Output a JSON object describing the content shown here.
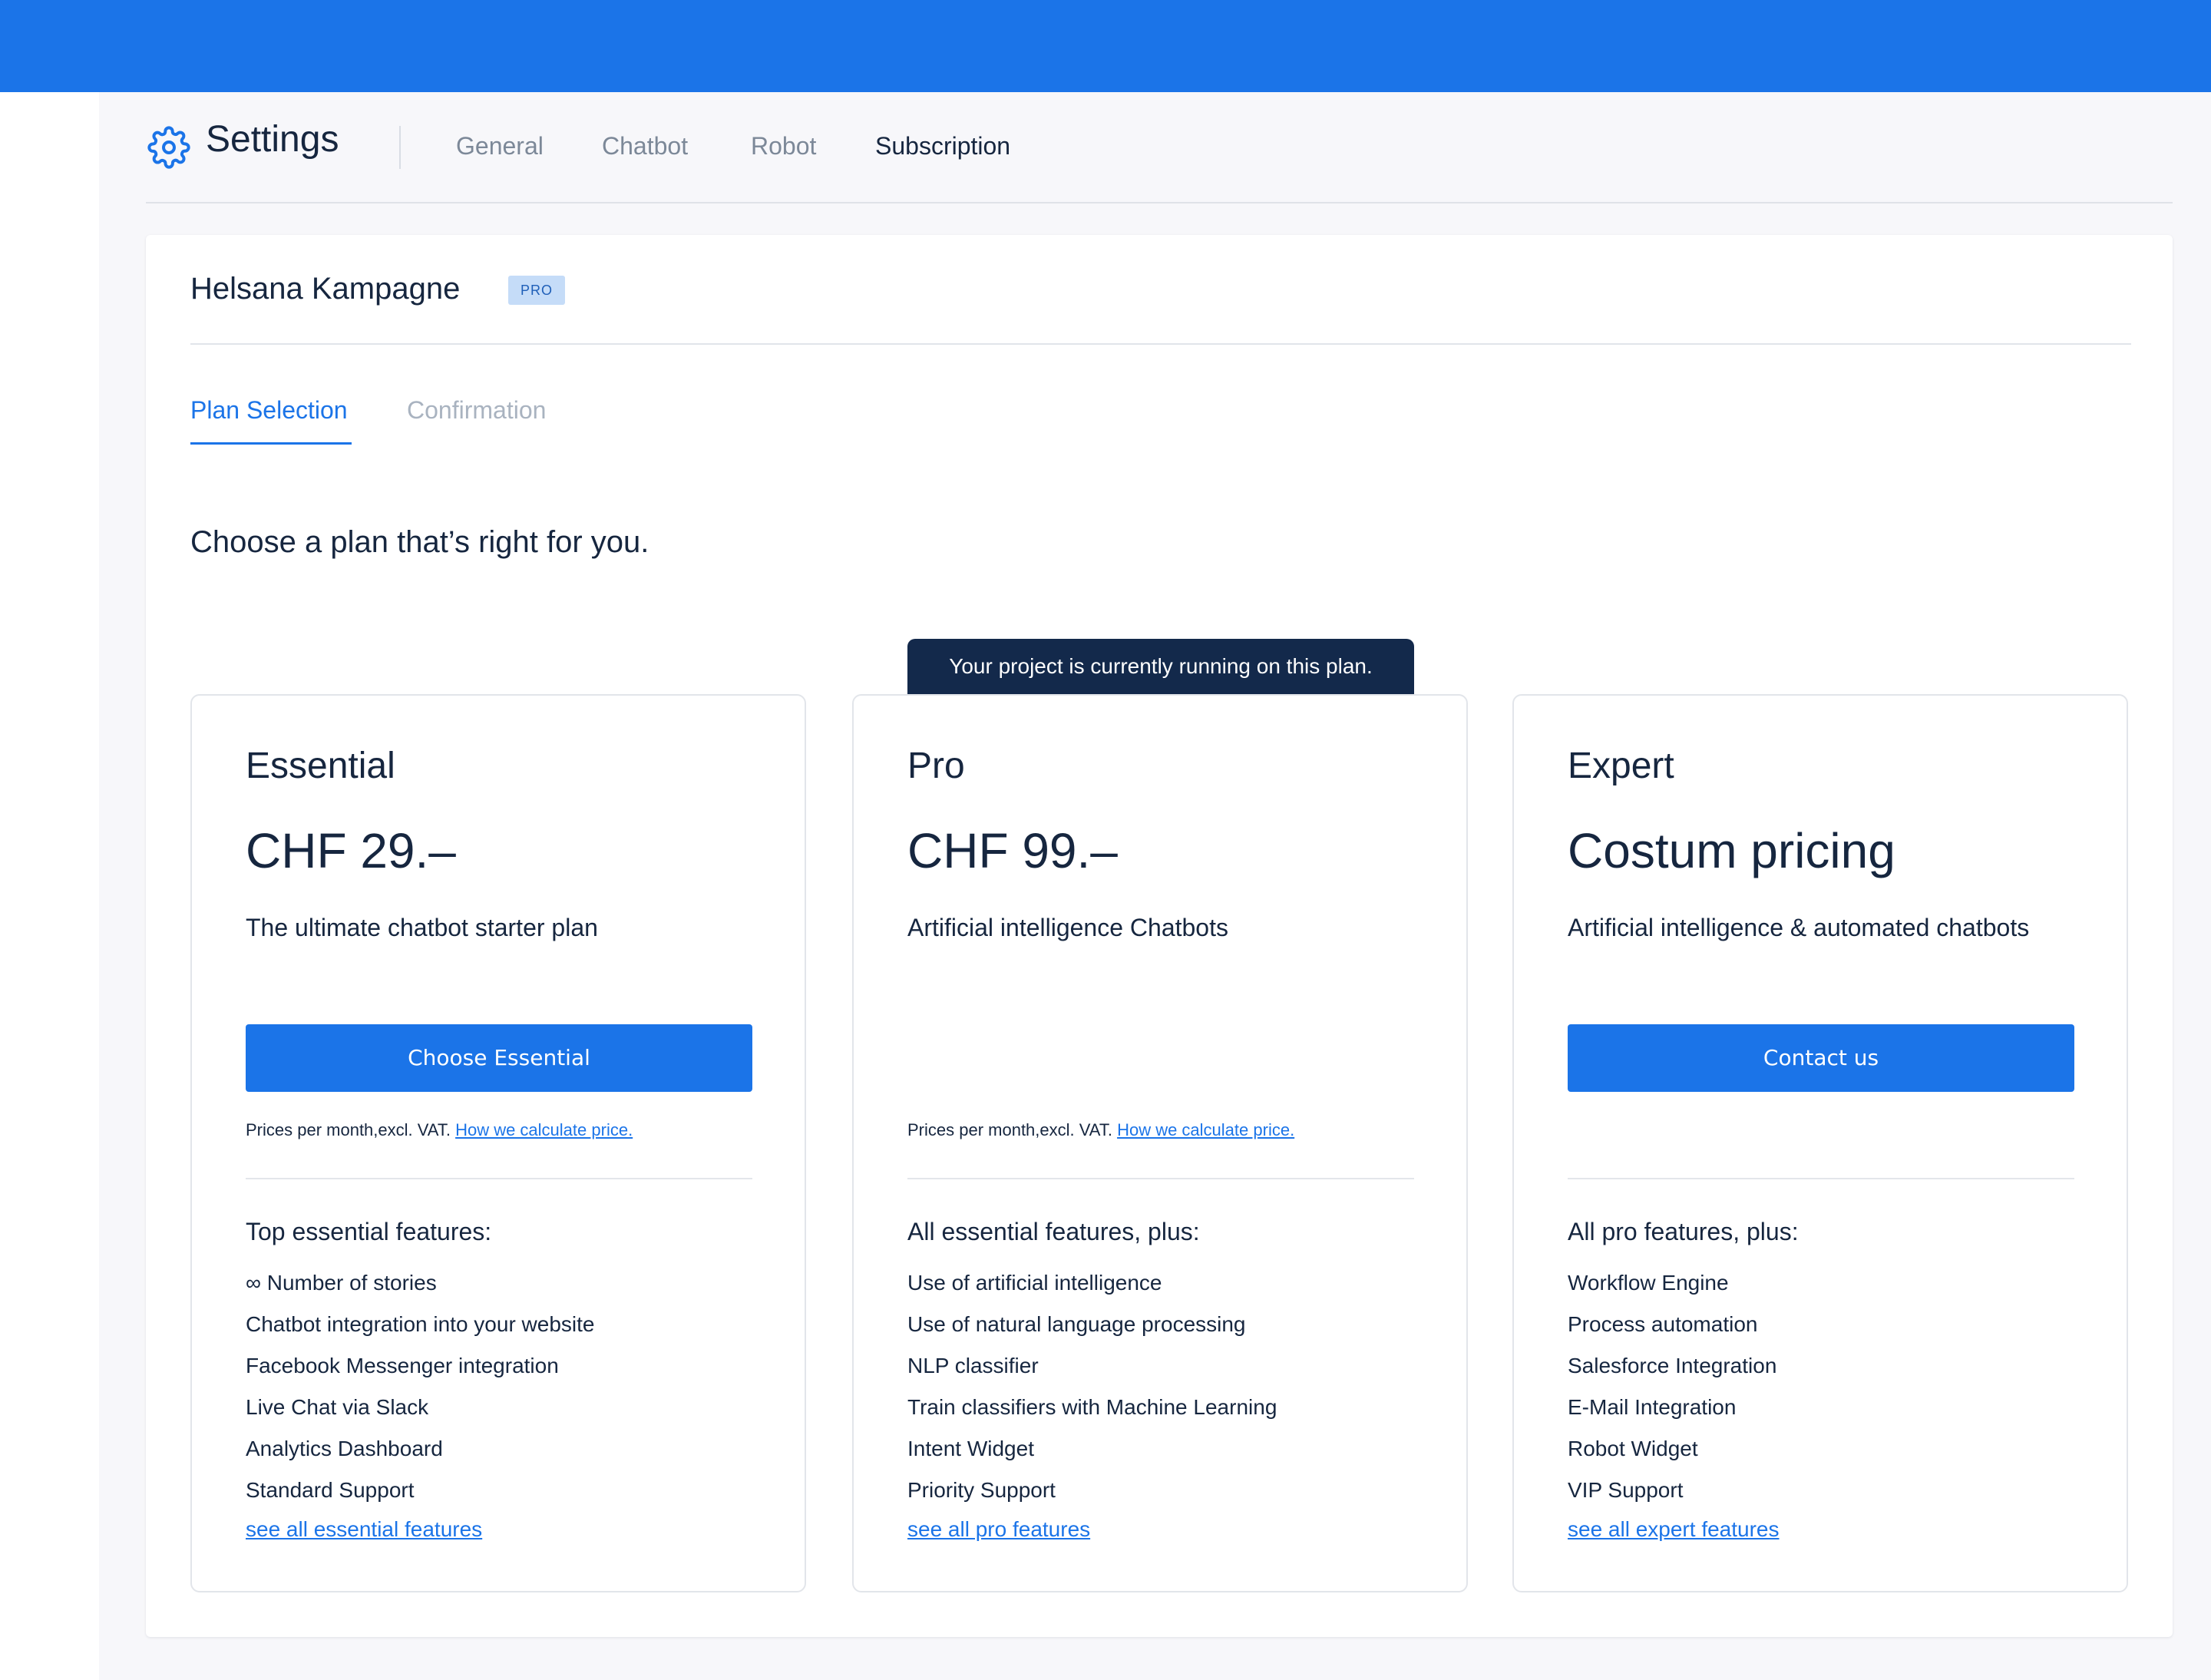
{
  "header": {
    "title": "Settings",
    "tabs": [
      "General",
      "Chatbot",
      "Robot",
      "Subscription"
    ]
  },
  "project": {
    "name": "Helsana Kampagne",
    "badge": "PRO"
  },
  "steps": [
    "Plan Selection",
    "Confirmation"
  ],
  "headline": "Choose a plan that’s right for you.",
  "current_plan_note": "Your project is currently running on this plan.",
  "plans": [
    {
      "name": "Essential",
      "price": "CHF 29.–",
      "description": "The ultimate chatbot starter plan",
      "button": "Choose Essential",
      "price_note": "Prices per month,excl. VAT.",
      "price_link": "How we calculate price.",
      "features_heading": "Top essential features:",
      "features": [
        "∞ Number of stories",
        "Chatbot integration into your website",
        "Facebook Messenger integration",
        "Live Chat via Slack",
        "Analytics Dashboard",
        "Standard Support"
      ],
      "features_link": "see all essential features"
    },
    {
      "name": "Pro",
      "price": "CHF 99.–",
      "description": "Artificial intelligence Chatbots",
      "price_note": "Prices per month,excl. VAT.",
      "price_link": "How we calculate price.",
      "features_heading": "All essential features, plus:",
      "features": [
        "Use of artificial intelligence",
        "Use of natural language processing",
        "NLP classifier",
        "Train classifiers with Machine Learning",
        "Intent Widget",
        "Priority Support"
      ],
      "features_link": "see all pro features"
    },
    {
      "name": "Expert",
      "price": "Costum pricing",
      "description": "Artificial intelligence & automated chatbots",
      "button": "Contact us",
      "features_heading": "All pro features, plus:",
      "features": [
        "Workflow Engine",
        "Process automation",
        "Salesforce Integration",
        "E-Mail Integration",
        "Robot Widget",
        "VIP Support"
      ],
      "features_link": "see all expert features"
    }
  ],
  "colors": {
    "accent": "#1b74e8",
    "dark": "#13294b",
    "text": "#16263f",
    "muted": "#7c8898",
    "badge_bg": "#c5dcf8"
  }
}
